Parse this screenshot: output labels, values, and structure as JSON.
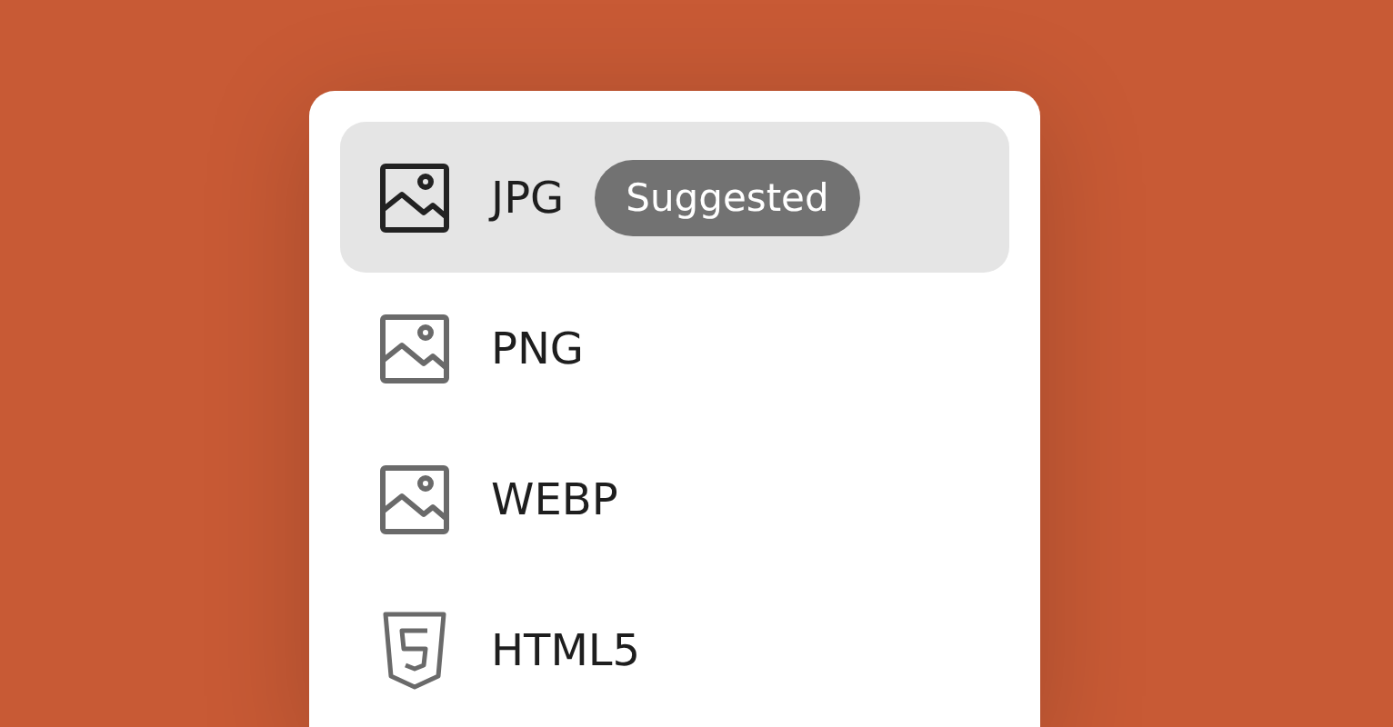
{
  "menu": {
    "items": [
      {
        "label": "JPG",
        "kind": "image",
        "selected": true,
        "badge": "Suggested"
      },
      {
        "label": "PNG",
        "kind": "image",
        "selected": false
      },
      {
        "label": "WEBP",
        "kind": "image",
        "selected": false
      },
      {
        "label": "HTML5",
        "kind": "html5",
        "selected": false
      }
    ]
  }
}
